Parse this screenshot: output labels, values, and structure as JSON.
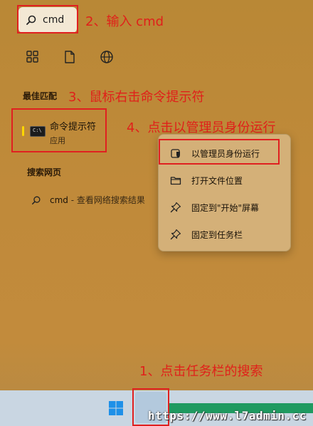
{
  "search": {
    "value": "cmd"
  },
  "annotations": {
    "step1": "1、点击任务栏的搜索",
    "step2": "2、输入 cmd",
    "step3": "3、鼠标右击命令提示符",
    "step4": "4、点击以管理员身份运行"
  },
  "filters": [
    {
      "icon": "apps-grid-icon"
    },
    {
      "icon": "document-icon"
    },
    {
      "icon": "globe-icon"
    }
  ],
  "sections": {
    "best_match": "最佳匹配",
    "web": "搜索网页"
  },
  "best_match": {
    "title": "命令提示符",
    "subtitle": "应用",
    "icon_text": "C:\\"
  },
  "web_result": {
    "query": "cmd",
    "suffix": " - 查看网络搜索结果"
  },
  "context_menu": [
    {
      "label": "以管理员身份运行",
      "icon": "shield-icon"
    },
    {
      "label": "打开文件位置",
      "icon": "folder-icon"
    },
    {
      "label": "固定到\"开始\"屏幕",
      "icon": "pin-icon"
    },
    {
      "label": "固定到任务栏",
      "icon": "pin-icon"
    }
  ],
  "watermark": "https://www.l7admin.cc",
  "colors": {
    "annotation_red": "#e0201a",
    "accent_yellow": "#ffd700"
  }
}
